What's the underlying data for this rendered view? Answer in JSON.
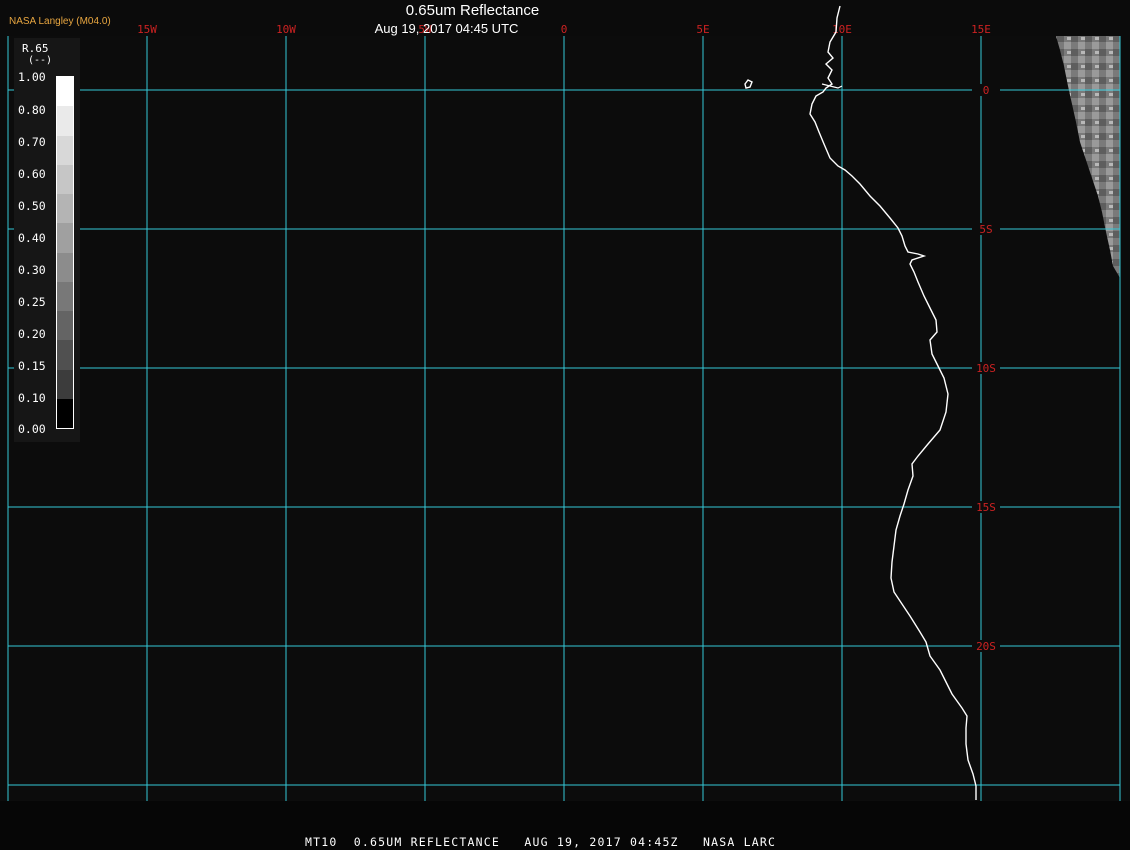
{
  "header": {
    "org": "NASA Langley (M04.0)",
    "title": "0.65um Reflectance",
    "timestamp": "Aug 19, 2017 04:45 UTC"
  },
  "footer": {
    "caption": "MT10  0.65UM REFLECTANCE   AUG 19, 2017 04:45Z   NASA LARC"
  },
  "legend": {
    "title": "R.65",
    "unit": "(--)",
    "ticks": [
      "1.00",
      "0.80",
      "0.70",
      "0.60",
      "0.50",
      "0.40",
      "0.30",
      "0.25",
      "0.20",
      "0.15",
      "0.10",
      "0.00"
    ],
    "color_steps": [
      "#ffffff",
      "#eaeaea",
      "#d8d8d8",
      "#c6c6c6",
      "#b4b4b4",
      "#a0a0a0",
      "#8c8c8c",
      "#787878",
      "#646464",
      "#505050",
      "#3c3c3c",
      "#000000"
    ]
  },
  "map": {
    "longitude_labels": [
      "15W",
      "10W",
      "5W",
      "0",
      "5E",
      "10E",
      "15E"
    ],
    "latitude_labels": [
      "0",
      "5S",
      "10S",
      "15S",
      "20S"
    ],
    "colors": {
      "gridline": "#34c7d6",
      "grid_label": "#cc2222",
      "coastline": "#ffffff",
      "background": "#0c0c0c"
    }
  }
}
